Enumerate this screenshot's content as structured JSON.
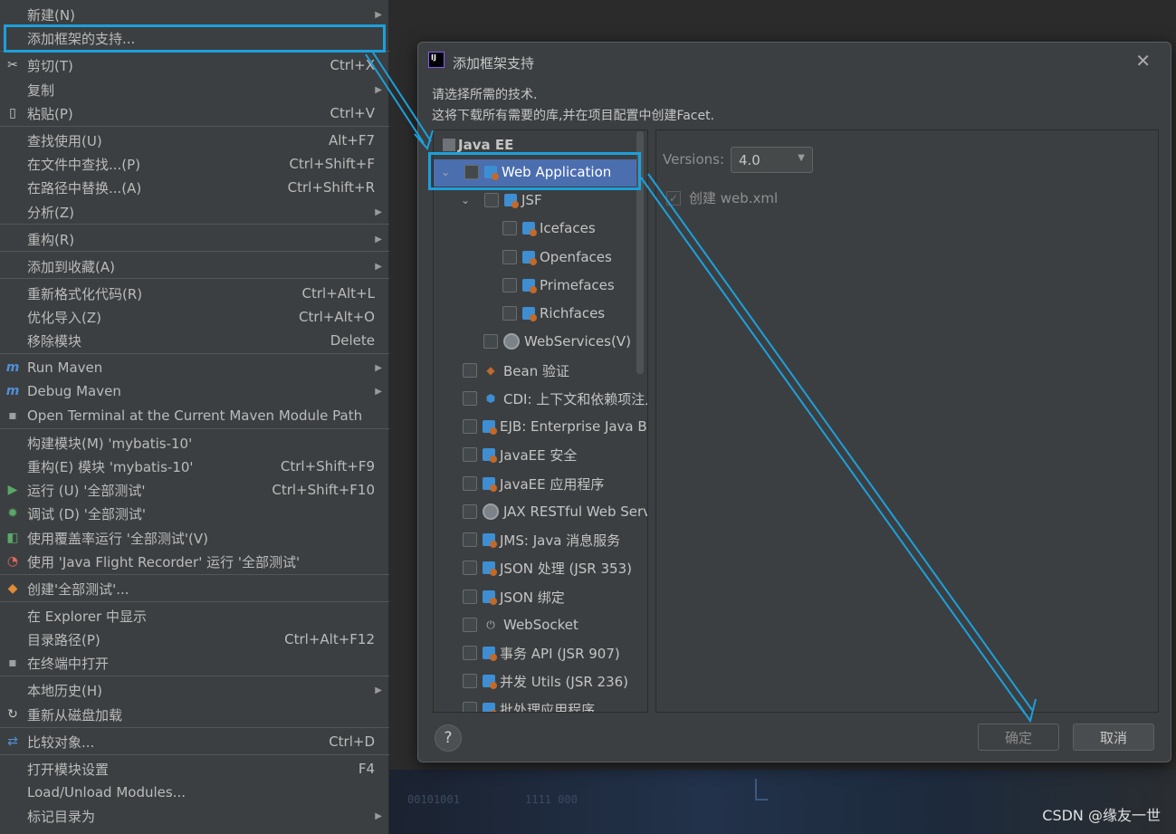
{
  "context_menu": {
    "items": [
      {
        "label": "新建(N)",
        "shortcut": "",
        "submenu": true,
        "icon": ""
      },
      {
        "label": "添加框架的支持...",
        "shortcut": "",
        "submenu": false,
        "icon": ""
      },
      {
        "label": "剪切(T)",
        "shortcut": "Ctrl+X",
        "submenu": false,
        "icon": "scissors-icon"
      },
      {
        "label": "复制",
        "shortcut": "",
        "submenu": true,
        "icon": ""
      },
      {
        "label": "粘贴(P)",
        "shortcut": "Ctrl+V",
        "submenu": false,
        "icon": "clipboard-icon"
      },
      {
        "label": "查找使用(U)",
        "shortcut": "Alt+F7",
        "submenu": false,
        "icon": ""
      },
      {
        "label": "在文件中查找...(P)",
        "shortcut": "Ctrl+Shift+F",
        "submenu": false,
        "icon": ""
      },
      {
        "label": "在路径中替换...(A)",
        "shortcut": "Ctrl+Shift+R",
        "submenu": false,
        "icon": ""
      },
      {
        "label": "分析(Z)",
        "shortcut": "",
        "submenu": true,
        "icon": ""
      },
      {
        "label": "重构(R)",
        "shortcut": "",
        "submenu": true,
        "icon": ""
      },
      {
        "label": "添加到收藏(A)",
        "shortcut": "",
        "submenu": true,
        "icon": ""
      },
      {
        "label": "重新格式化代码(R)",
        "shortcut": "Ctrl+Alt+L",
        "submenu": false,
        "icon": ""
      },
      {
        "label": "优化导入(Z)",
        "shortcut": "Ctrl+Alt+O",
        "submenu": false,
        "icon": ""
      },
      {
        "label": "移除模块",
        "shortcut": "Delete",
        "submenu": false,
        "icon": ""
      },
      {
        "label": "Run Maven",
        "shortcut": "",
        "submenu": true,
        "icon": "maven-run-icon"
      },
      {
        "label": "Debug Maven",
        "shortcut": "",
        "submenu": true,
        "icon": "maven-debug-icon"
      },
      {
        "label": "Open Terminal at the Current Maven Module Path",
        "shortcut": "",
        "submenu": false,
        "icon": "terminal-icon"
      },
      {
        "label": "构建模块(M) 'mybatis-10'",
        "shortcut": "",
        "submenu": false,
        "icon": ""
      },
      {
        "label": "重构(E) 模块 'mybatis-10'",
        "shortcut": "Ctrl+Shift+F9",
        "submenu": false,
        "icon": ""
      },
      {
        "label": "运行 (U) '全部测试'",
        "shortcut": "Ctrl+Shift+F10",
        "submenu": false,
        "icon": "run-icon"
      },
      {
        "label": "调试 (D) '全部测试'",
        "shortcut": "",
        "submenu": false,
        "icon": "debug-icon"
      },
      {
        "label": "使用覆盖率运行 '全部测试'(V)",
        "shortcut": "",
        "submenu": false,
        "icon": "coverage-icon"
      },
      {
        "label": "使用 'Java Flight Recorder' 运行 '全部测试'",
        "shortcut": "",
        "submenu": false,
        "icon": "profiler-icon"
      },
      {
        "label": "创建'全部测试'...",
        "shortcut": "",
        "submenu": false,
        "icon": "create-config-icon"
      },
      {
        "label": "在 Explorer 中显示",
        "shortcut": "",
        "submenu": false,
        "icon": ""
      },
      {
        "label": "目录路径(P)",
        "shortcut": "Ctrl+Alt+F12",
        "submenu": false,
        "icon": ""
      },
      {
        "label": "在终端中打开",
        "shortcut": "",
        "submenu": false,
        "icon": "terminal-small-icon"
      },
      {
        "label": "本地历史(H)",
        "shortcut": "",
        "submenu": true,
        "icon": ""
      },
      {
        "label": "重新从磁盘加载",
        "shortcut": "",
        "submenu": false,
        "icon": "reload-icon"
      },
      {
        "label": "比较对象...",
        "shortcut": "Ctrl+D",
        "submenu": false,
        "icon": "compare-icon"
      },
      {
        "label": "打开模块设置",
        "shortcut": "F4",
        "submenu": false,
        "icon": ""
      },
      {
        "label": "Load/Unload Modules...",
        "shortcut": "",
        "submenu": false,
        "icon": ""
      },
      {
        "label": "标记目录为",
        "shortcut": "",
        "submenu": true,
        "icon": ""
      }
    ]
  },
  "dialog": {
    "title": "添加框架支持",
    "description_line1": "请选择所需的技术.",
    "description_line2": "这将下载所有需要的库,并在项目配置中创建Facet.",
    "tree_group": "Java EE",
    "tree_items": [
      {
        "label": "Web Application",
        "selected": true
      },
      {
        "label": "JSF"
      },
      {
        "label": "Icefaces"
      },
      {
        "label": "Openfaces"
      },
      {
        "label": "Primefaces"
      },
      {
        "label": "Richfaces"
      },
      {
        "label": "WebServices(V)"
      },
      {
        "label": "Bean 验证"
      },
      {
        "label": "CDI: 上下文和依赖项注入"
      },
      {
        "label": "EJB: Enterprise Java Beans"
      },
      {
        "label": "JavaEE 安全"
      },
      {
        "label": "JavaEE 应用程序"
      },
      {
        "label": "JAX RESTful Web Services"
      },
      {
        "label": "JMS: Java 消息服务"
      },
      {
        "label": "JSON 处理 (JSR 353)"
      },
      {
        "label": "JSON 绑定"
      },
      {
        "label": "WebSocket"
      },
      {
        "label": "事务 API (JSR 907)"
      },
      {
        "label": "并发 Utils (JSR 236)"
      },
      {
        "label": "批处理应用程序"
      }
    ],
    "versions_label": "Versions:",
    "versions_value": "4.0",
    "create_webxml_label": "创建 web.xml",
    "create_webxml_checked": true,
    "help_label": "?",
    "ok_label": "确定",
    "cancel_label": "取消"
  },
  "annotation_color": "#1ca0dc",
  "watermark": "CSDN @缘友一世"
}
